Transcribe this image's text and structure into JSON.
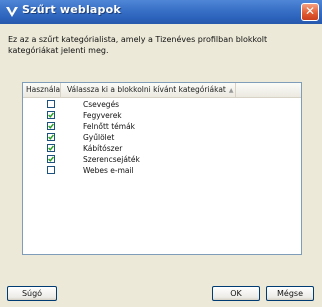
{
  "window": {
    "title": "Szűrt weblapok",
    "close_label": "✕"
  },
  "description": "Ez az a szűrt kategórialista, amely a Tizenéves profilban blokkolt kategóriákat jelenti meg.",
  "list": {
    "columns": [
      "Használa...",
      "Válassza ki a blokkolni kívánt kategóriákat"
    ],
    "sort_indicator": "▲",
    "items": [
      {
        "label": "Csevegés",
        "checked": false
      },
      {
        "label": "Fegyverek",
        "checked": true
      },
      {
        "label": "Felnőtt témák",
        "checked": true
      },
      {
        "label": "Gyűlölet",
        "checked": true
      },
      {
        "label": "Kábítószer",
        "checked": true
      },
      {
        "label": "Szerencsejáték",
        "checked": true
      },
      {
        "label": "Webes e-mail",
        "checked": false
      }
    ]
  },
  "buttons": {
    "help": "Súgó",
    "ok": "OK",
    "cancel": "Mégse"
  }
}
